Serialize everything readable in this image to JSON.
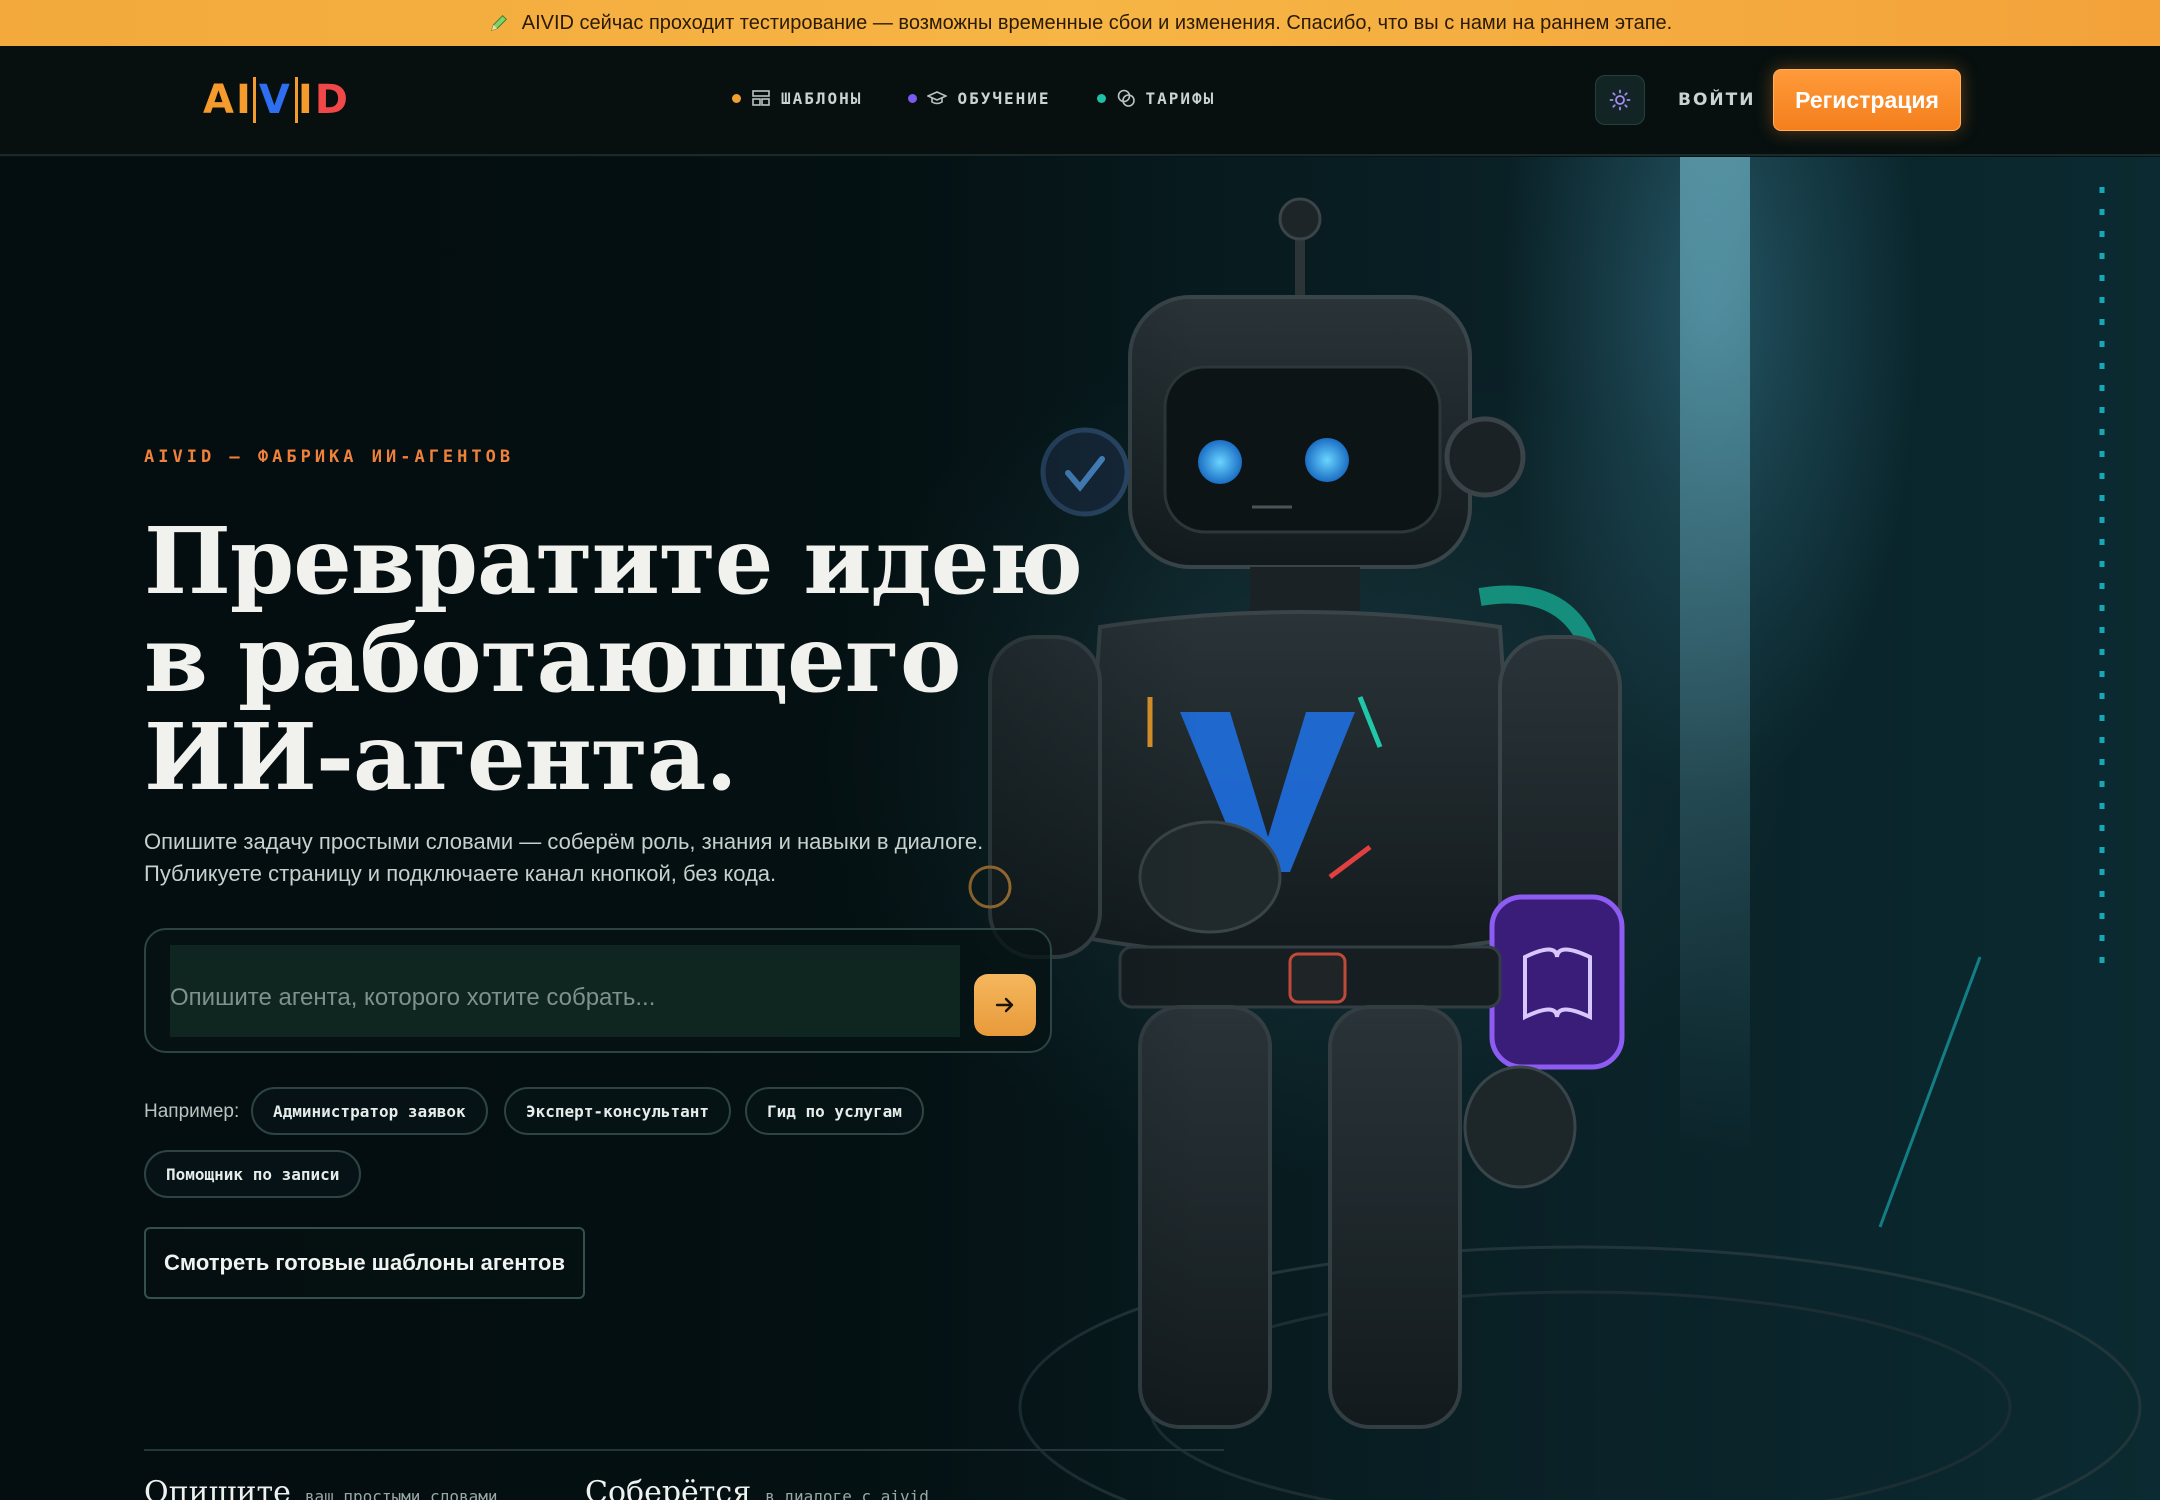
{
  "announcement": {
    "icon": "pen-icon",
    "text": "AIVID сейчас проходит тестирование — возможны временные сбои и изменения. Спасибо, что вы с нами на раннем этапе."
  },
  "header": {
    "logo": {
      "a": "AI",
      "v": "V",
      "rest_i": "I",
      "d": "D"
    },
    "nav": [
      {
        "label": "ШАБЛОНЫ",
        "dot_color": "#f0a030",
        "icon": "layout-icon"
      },
      {
        "label": "ОБУЧЕНИЕ",
        "dot_color": "#7a5af0",
        "icon": "graduation-cap-icon"
      },
      {
        "label": "ТАРИФЫ",
        "dot_color": "#20c0a8",
        "icon": "coins-icon"
      }
    ],
    "theme_icon": "sun-icon",
    "login_label": "ВОЙТИ",
    "register_label": "Регистрация"
  },
  "hero": {
    "eyebrow": "AIVID — ФАБРИКА ИИ-АГЕНТОВ",
    "headline": "Превратите идею в работающего ИИ-агента.",
    "subtitle_line1": "Опишите задачу простыми словами — соберём роль, знания и навыки в диалоге.",
    "subtitle_line2": "Публикуете страницу и подключаете канал кнопкой, без кода.",
    "prompt_placeholder": "Опишите агента, которого хотите собрать...",
    "examples_label": "Например:",
    "examples": [
      "Администратор заявок",
      "Эксперт-консультант",
      "Гид по услугам",
      "Помощник по записи"
    ],
    "templates_button": "Смотреть готовые шаблоны агентов"
  },
  "steps": [
    {
      "title": "Опишите",
      "desc": "ваш простыми словами"
    },
    {
      "title": "Соберётся",
      "desc": "в диалоге с aivid"
    }
  ],
  "colors": {
    "accent": "#f47f1c",
    "announcement": "#f6b545",
    "background": "#061214"
  }
}
